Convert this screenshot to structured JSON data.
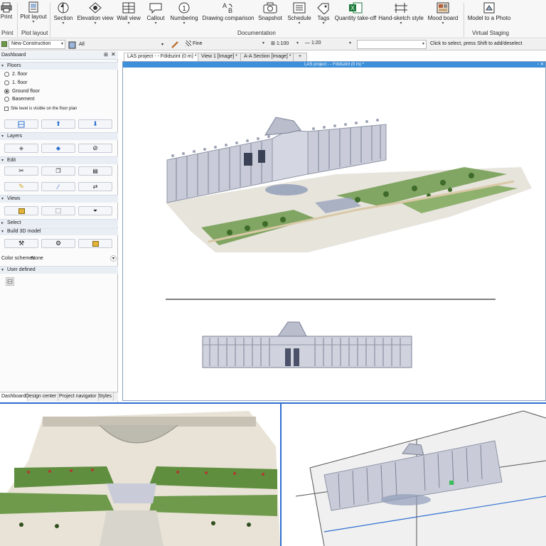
{
  "ribbon": {
    "buttons": [
      {
        "label": "Print",
        "icon": "printer-icon"
      },
      {
        "label": "Plot layout",
        "icon": "plot-layout-icon"
      },
      {
        "label": "Section",
        "icon": "section-icon"
      },
      {
        "label": "Elevation view",
        "icon": "elevation-view-icon"
      },
      {
        "label": "Wall view",
        "icon": "wall-view-icon"
      },
      {
        "label": "Callout",
        "icon": "callout-icon"
      },
      {
        "label": "Numbering",
        "icon": "numbering-icon"
      },
      {
        "label": "Drawing comparison",
        "icon": "drawing-comparison-icon"
      },
      {
        "label": "Snapshot",
        "icon": "camera-icon"
      },
      {
        "label": "Schedule",
        "icon": "schedule-icon"
      },
      {
        "label": "Tags",
        "icon": "tag-icon"
      },
      {
        "label": "Quantity take-off",
        "icon": "excel-icon"
      },
      {
        "label": "Hand-sketch style",
        "icon": "hand-sketch-icon"
      },
      {
        "label": "Mood board",
        "icon": "mood-board-icon"
      },
      {
        "label": "Model to a Photo",
        "icon": "model-to-photo-icon"
      }
    ],
    "groups": [
      "Print",
      "Plot layout",
      "Documentation",
      "Virtual Staging"
    ]
  },
  "toolbar2": {
    "construction": "New Construction",
    "layer_filter": "All",
    "detail": "Fine",
    "scale": "1:100",
    "line_scale": "1:20",
    "hint": "Click to select, press Shift to add/deselect"
  },
  "dashboard": {
    "title": "Dashboard",
    "floors_header": "Floors",
    "floors": [
      "2. floor",
      "1. floor",
      "Ground floor",
      "Basement"
    ],
    "selected_floor": "Ground floor",
    "site_level_text": "Site level is visible on the floor plan",
    "sections": [
      "Layers",
      "Edit",
      "Views",
      "Select",
      "Build 3D model"
    ],
    "color_schemes_label": "Color schemes",
    "color_schemes_value": "None",
    "user_defined": "User defined",
    "bottom_tabs": [
      "Dashboard",
      "Design center",
      "Project navigator",
      "Styles"
    ]
  },
  "doc_tabs": [
    "LAS project - - Földszint (0 m) *",
    "View 1 [Image] *",
    "A-A Section [Image] *",
    "+"
  ],
  "viewport": {
    "title": "LAS project - - Földszint (0 m) *"
  },
  "colors": {
    "accent": "#2e6fd0",
    "title_bar": "#3c8fd8",
    "panel_header": "#e9eef5",
    "lawn": "#6f9a4c",
    "facade": "#c9ccd8",
    "excel_green": "#1d7a3c"
  }
}
